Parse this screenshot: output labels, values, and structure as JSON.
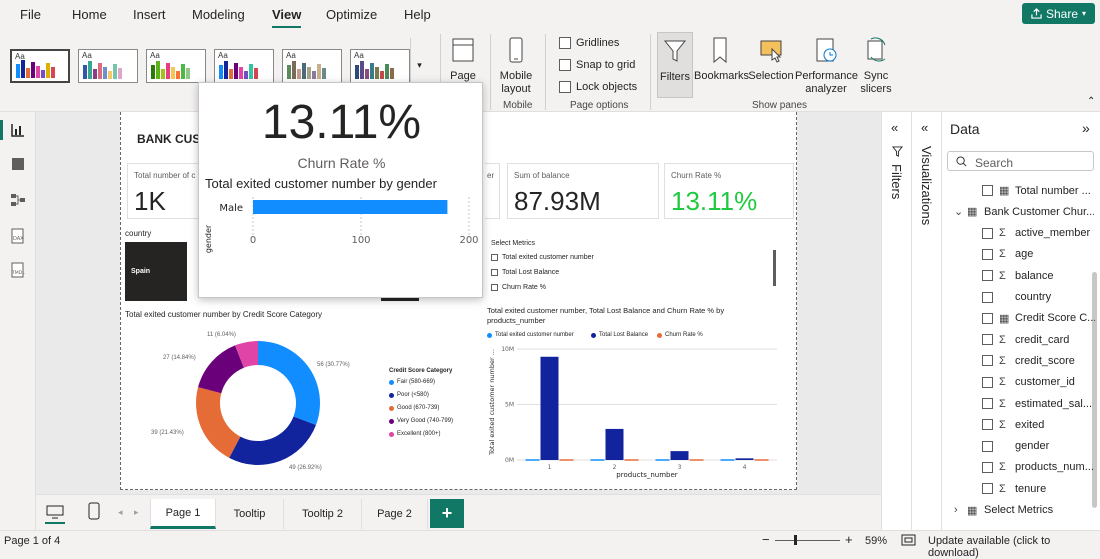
{
  "menu": {
    "items": [
      "File",
      "Home",
      "Insert",
      "Modeling",
      "View",
      "Optimize",
      "Help"
    ],
    "active": "View",
    "share_label": "Share"
  },
  "ribbon": {
    "page_view_label": "Page view",
    "mobile_label": "Mobile layout",
    "mobile_group": "Mobile",
    "gridlines": "Gridlines",
    "snap": "Snap to grid",
    "lock": "Lock objects",
    "page_options_group": "Page options",
    "filters": "Filters",
    "bookmarks": "Bookmarks",
    "selection": "Selection",
    "perf": "Performance analyzer",
    "sync": "Sync slicers",
    "show_panes_group": "Show panes"
  },
  "report": {
    "title": "BANK CUS",
    "cards": [
      {
        "label": "Total number of c",
        "value": "1K"
      },
      {
        "label": "er",
        "value": ""
      },
      {
        "label": "Sum of balance",
        "value": "87.93M"
      },
      {
        "label": "Churn Rate %",
        "value": "13.11%",
        "color": "#21c940"
      }
    ],
    "country_label": "country",
    "country_tile": "Spain",
    "select_metrics": {
      "title": "Select Metrics",
      "items": [
        "Total exited customer number",
        "Total Lost Balance",
        "Churn Rate %"
      ]
    }
  },
  "tooltip": {
    "big_value": "13.11%",
    "big_label": "Churn Rate %",
    "chart_title": "Total exited customer number by gender"
  },
  "chart_data": [
    {
      "type": "bar",
      "title": "Total exited customer number by gender",
      "categories": [
        "Male"
      ],
      "values": [
        180
      ],
      "ylabel": "gender",
      "xlim": [
        0,
        200
      ],
      "ticks": [
        "0",
        "100",
        "200"
      ],
      "color": "#118dff"
    },
    {
      "type": "pie",
      "title": "Total exited customer number by Credit Score Category",
      "legend_title": "Credit Score Category",
      "slices": [
        {
          "name": "Fair (580-669)",
          "value": 56,
          "label": "56 (30.77%)",
          "color": "#118dff"
        },
        {
          "name": "Poor (<580)",
          "value": 49,
          "label": "49 (26.92%)",
          "color": "#12239e"
        },
        {
          "name": "Good (670-739)",
          "value": 39,
          "label": "39 (21.43%)",
          "color": "#e66c37"
        },
        {
          "name": "Very Good (740-799)",
          "value": 27,
          "label": "27 (14.84%)",
          "color": "#6b007b"
        },
        {
          "name": "Excellent (800+)",
          "value": 11,
          "label": "11 (6.04%)",
          "color": "#e044a7"
        }
      ]
    },
    {
      "type": "bar",
      "title": "Total exited customer number, Total Lost Balance and Churn Rate % by products_number",
      "legend": [
        {
          "name": "Total exited customer number",
          "color": "#118dff"
        },
        {
          "name": "Total Lost Balance",
          "color": "#12239e"
        },
        {
          "name": "Churn Rate %",
          "color": "#e66c37"
        }
      ],
      "categories": [
        "1",
        "2",
        "3",
        "4"
      ],
      "series": [
        {
          "name": "Total Lost Balance",
          "values": [
            9.3,
            2.8,
            0.8,
            0.15
          ]
        }
      ],
      "ylabel": "Total exited customer number ...",
      "xlabel": "products_number",
      "ylim": [
        0,
        10
      ],
      "yticks": [
        "0M",
        "5M",
        "10M"
      ]
    }
  ],
  "filters_pane": {
    "label": "Filters"
  },
  "viz_pane": {
    "label": "Visualizations"
  },
  "data_pane": {
    "title": "Data",
    "search_placeholder": "Search",
    "fields": [
      {
        "name": "Total number ...",
        "type": "calc",
        "indent": 1
      },
      {
        "name": "Bank Customer Chur...",
        "type": "table",
        "indent": 0
      },
      {
        "name": "active_member",
        "type": "sigma",
        "indent": 2
      },
      {
        "name": "age",
        "type": "sigma",
        "indent": 2
      },
      {
        "name": "balance",
        "type": "sigma",
        "indent": 2
      },
      {
        "name": "country",
        "type": "none",
        "indent": 2
      },
      {
        "name": "Credit Score C...",
        "type": "calc",
        "indent": 2
      },
      {
        "name": "credit_card",
        "type": "sigma",
        "indent": 2
      },
      {
        "name": "credit_score",
        "type": "sigma",
        "indent": 2
      },
      {
        "name": "customer_id",
        "type": "sigma",
        "indent": 2
      },
      {
        "name": "estimated_sal...",
        "type": "sigma",
        "indent": 2
      },
      {
        "name": "exited",
        "type": "sigma",
        "indent": 2
      },
      {
        "name": "gender",
        "type": "none",
        "indent": 2
      },
      {
        "name": "products_num...",
        "type": "sigma",
        "indent": 2
      },
      {
        "name": "tenure",
        "type": "sigma",
        "indent": 2
      },
      {
        "name": "Select Metrics",
        "type": "table",
        "indent": 0
      }
    ]
  },
  "tabs": [
    "Page 1",
    "Tooltip",
    "Tooltip 2",
    "Page 2"
  ],
  "status": {
    "page": "Page 1 of 4",
    "zoom": "59%",
    "update": "Update available (click to download)"
  }
}
